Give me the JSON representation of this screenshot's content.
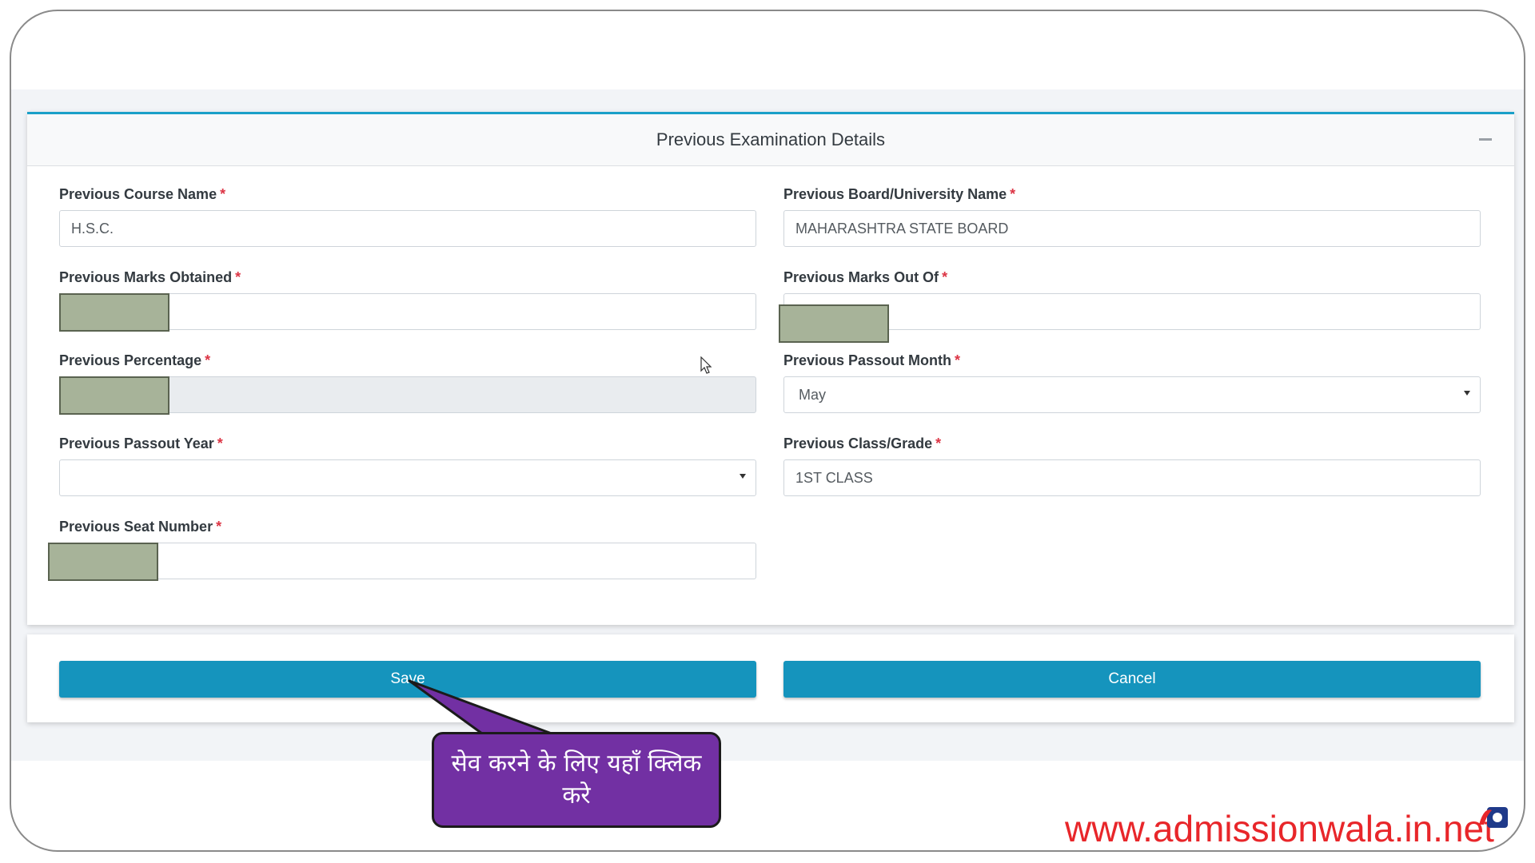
{
  "card": {
    "title": "Previous Examination Details"
  },
  "fields": {
    "course_name": {
      "label": "Previous Course Name",
      "value": "H.S.C."
    },
    "board_name": {
      "label": "Previous Board/University Name",
      "value": "MAHARASHTRA STATE BOARD"
    },
    "marks_obtained": {
      "label": "Previous Marks Obtained",
      "value": ""
    },
    "marks_out_of": {
      "label": "Previous Marks Out Of",
      "value": ""
    },
    "percentage": {
      "label": "Previous Percentage",
      "value": ""
    },
    "passout_month": {
      "label": "Previous Passout Month",
      "value": "May"
    },
    "passout_year": {
      "label": "Previous Passout Year",
      "value": ""
    },
    "class_grade": {
      "label": "Previous Class/Grade",
      "value": "1ST CLASS"
    },
    "seat_number": {
      "label": "Previous Seat Number",
      "value": ""
    }
  },
  "required_marker": "*",
  "buttons": {
    "save": "Save",
    "cancel": "Cancel"
  },
  "callout": {
    "text": "सेव करने के लिए यहाँ क्लिक करे"
  },
  "watermark": "www.admissionwala.in.net",
  "colors": {
    "accent": "#1594bd",
    "card_border_top": "#1aa0c8",
    "required": "#dc3545",
    "callout_bg": "#7230a3",
    "watermark": "#e8262a",
    "redaction": "#a7b399"
  }
}
